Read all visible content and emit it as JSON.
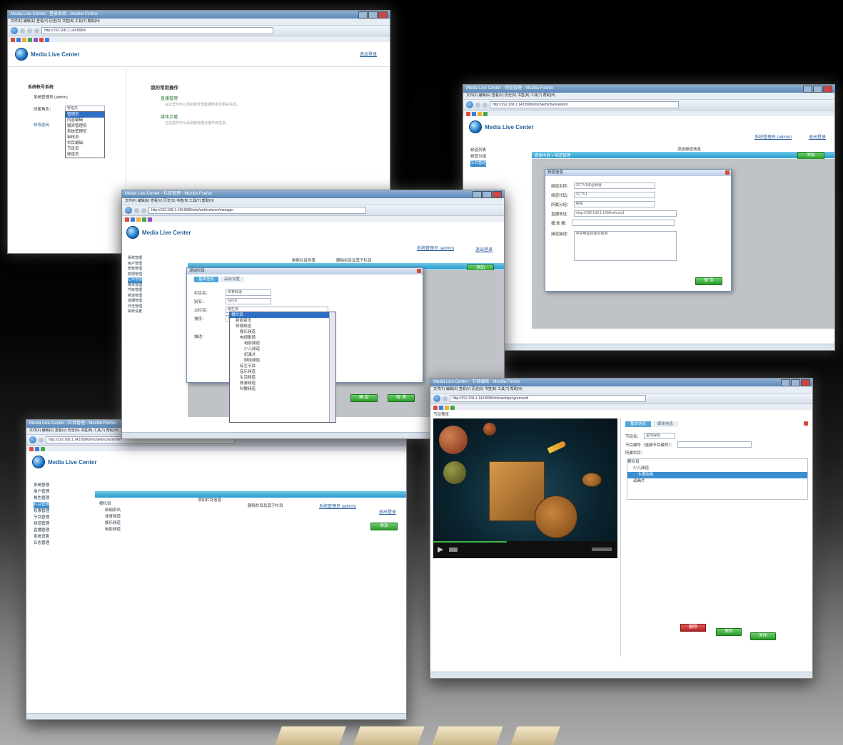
{
  "app_name": "Media Live Center",
  "windows": {
    "w1": {
      "title": "Media Live Center - 登录系统 - Mozilla Firefox",
      "url": "http://192.168.1.143:8080/",
      "menu": "文件(F)  编辑(E)  查看(V)  历史(S)  书签(B)  工具(T)  帮助(H)",
      "top_link": "退出登录",
      "left_heading": "系统帐号系统",
      "account_label": "系统管理员 (admin)",
      "role_label": "所属角色：",
      "role_selected": "管理员",
      "role_options": [
        "管理员",
        "内容编辑",
        "媒资管理员",
        "系统管理员",
        "审核员",
        "栏目编辑",
        "节目员",
        "频道员"
      ],
      "left_link": "修改密码",
      "right_heading": "我的常用操作",
      "ops": [
        {
          "title": "直播管理",
          "desc": "在这里你可以添加和管理直播频道及相关信息。"
        },
        {
          "title": "媒体点播",
          "desc": "在这里你可以添加和管理点播节目信息。"
        }
      ]
    },
    "w2": {
      "title": "Media Live Center - 频道管理 - Mozilla Firefox",
      "url": "http://192.168.1.143:8080/mlc/web/channel/edit",
      "account_link": "系统管理员 (admin)",
      "logout_link": "退出登录",
      "tree": [
        "频道列表",
        "频道分组",
        "节目管理"
      ],
      "toolbar_text": "媒体内容 > 频道管理",
      "search_label": "添加频道信息",
      "add_button": "添加",
      "dialog_title": "频道信息",
      "fields": [
        {
          "label": "频道名称：",
          "value": "CCTV1综合频道"
        },
        {
          "label": "频道代码：",
          "value": "CCTV1"
        },
        {
          "label": "所属分组：",
          "value": "央视"
        },
        {
          "label": "直播地址：",
          "value": "rtmp://192.168.1.143/live/cctv1"
        },
        {
          "label": "播  放  器：",
          "value": ""
        },
        {
          "label": "频道描述：",
          "value": "中央电视台综合频道"
        }
      ],
      "save_button": "保 存"
    },
    "w3": {
      "title": "Media Live Center - 栏目管理 - Mozilla Firefox",
      "url": "http://192.168.1.143:8080/mlc/web/column/manager",
      "account_link": "系统管理员 (admin)",
      "logout_link": "退出登录",
      "tree": [
        "系统管理",
        "用户管理",
        "角色管理",
        "权限管理",
        "栏目管理",
        "媒资管理",
        "节目管理",
        "频道管理",
        "直播管理",
        "日志管理",
        "系统设置"
      ],
      "toolbar_a": "刷新栏目列表",
      "toolbar_b": "删除栏目及其子栏目",
      "add_button": "添加",
      "dialog_title": "添加栏目",
      "tabs": [
        "基本信息",
        "高级设置"
      ],
      "fields": [
        {
          "label": "栏目名：",
          "value": "体育频道"
        },
        {
          "label": "别名：",
          "value": "sports"
        },
        {
          "label": "父栏目：",
          "value": "根栏目"
        },
        {
          "label": "排序：",
          "value": "1"
        },
        {
          "label": "描述：",
          "value": ""
        }
      ],
      "dropdown_items": [
        "根栏目",
        "新闻资讯",
        "体育频道",
        "娱乐频道",
        "电视剧场",
        "电影频道",
        "少儿频道",
        "纪录片",
        "财经频道",
        "综艺节目",
        "音乐频道",
        "生活频道",
        "旅游频道",
        "科教频道"
      ],
      "ok_button": "确 定",
      "cancel_button": "取 消"
    },
    "w4": {
      "title": "Media Live Center - 栏目管理 - Mozilla Firefox",
      "url": "http://192.168.1.143:8080/mlc/web/column/list",
      "account_link": "系统管理员 (admin)",
      "logout_link": "退出登录",
      "tree": [
        "系统管理",
        "用户管理",
        "角色管理",
        "栏目管理",
        "权限管理",
        "节目管理",
        "频道管理",
        "直播管理",
        "系统设置",
        "日志管理"
      ],
      "toolbar_a": "添加栏目信息",
      "toolbar_b": "删除栏目及其子栏目",
      "list": [
        "根栏目",
        "新闻资讯",
        "体育频道",
        "娱乐频道",
        "电影频道"
      ],
      "add_button": "添加"
    },
    "w5": {
      "title": "Media Live Center - 节目编辑 - Mozilla Firefox",
      "url": "http://192.168.1.143:8080/mlc/web/program/edit",
      "menu": "文件(F)  编辑(E)  查看(V)  历史(S)  书签(B)  工具(T)  帮助(H)",
      "left_title": "节目预览",
      "tabs": [
        "基本信息",
        "媒体信息"
      ],
      "fields": [
        {
          "label": "节目名：",
          "value": "星际探险"
        },
        {
          "label": "节目编号（选择节目编号）：",
          "value": ""
        },
        {
          "label": "所属栏目：",
          "value": ""
        }
      ],
      "tree": [
        "根栏目",
        "少儿频道",
        "卡通动画",
        "动画片"
      ],
      "buttons": [
        "删除",
        "保存",
        "关闭"
      ]
    }
  }
}
